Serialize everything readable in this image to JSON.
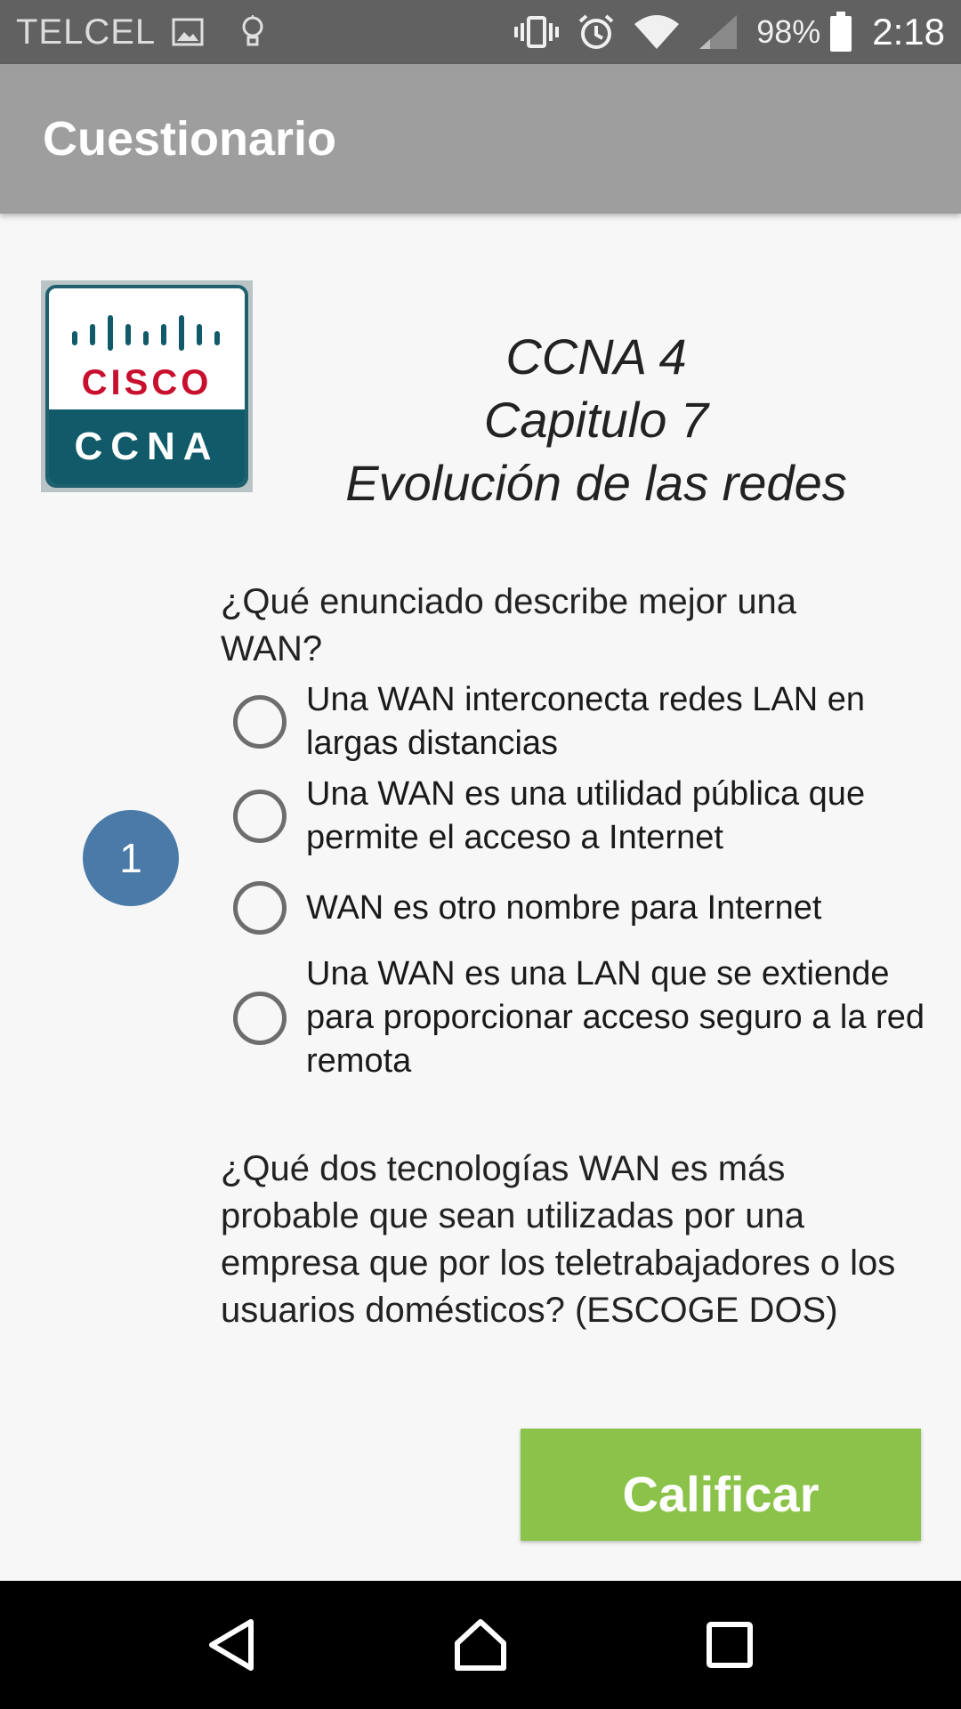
{
  "status_bar": {
    "carrier": "TELCEL",
    "battery_percent": "98%",
    "time": "2:18",
    "icons": [
      "image-icon",
      "lightbulb-icon",
      "vibrate-icon",
      "alarm-icon",
      "wifi-icon",
      "signal-icon",
      "battery-icon"
    ]
  },
  "app_bar": {
    "title": "Cuestionario"
  },
  "header": {
    "logo": {
      "brand": "CISCO",
      "subtitle": "CCNA"
    },
    "title_line1": "CCNA 4",
    "title_line2": "Capitulo 7",
    "title_line3": "Evolución de las redes"
  },
  "question1": {
    "number": "1",
    "text": "¿Qué enunciado describe mejor una WAN?",
    "options": [
      "Una WAN interconecta redes LAN en largas distancias",
      "Una WAN es una utilidad pública que permite el acceso a Internet",
      "WAN es otro nombre para Internet",
      "Una WAN es una LAN que se extiende para proporcionar acceso seguro a la red remota"
    ]
  },
  "question2": {
    "text": "¿Qué dos tecnologías WAN es más probable que sean utilizadas por una empresa que por los teletrabajadores o los usuarios domésticos? (ESCOGE DOS)"
  },
  "actions": {
    "grade_label": "Calificar"
  },
  "colors": {
    "accent_green": "#8bc34a",
    "badge_blue": "#4a7aa8",
    "app_bar": "#9e9e9e"
  }
}
